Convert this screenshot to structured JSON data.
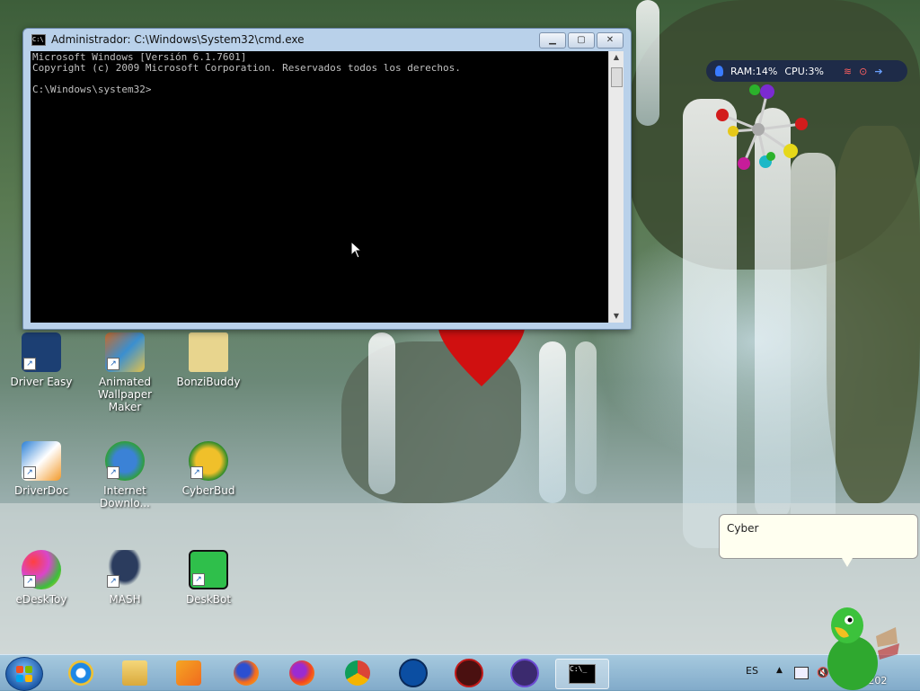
{
  "cmd_window": {
    "title": "Administrador: C:\\Windows\\System32\\cmd.exe",
    "lines": [
      "Microsoft Windows [Versión 6.1.7601]",
      "Copyright (c) 2009 Microsoft Corporation. Reservados todos los derechos.",
      "",
      "C:\\Windows\\system32>"
    ]
  },
  "monitor": {
    "ram": "RAM:14%",
    "cpu": "CPU:3%"
  },
  "desktop_icons": [
    {
      "label": "Driver Easy",
      "color": "#1c3f73"
    },
    {
      "label": "Animated Wallpaper Maker",
      "color": "#c66a2b"
    },
    {
      "label": "BonziBuddy",
      "color": "#e8d58e"
    },
    {
      "label": "DriverDoc",
      "color": "#2a7fd6"
    },
    {
      "label": "Internet Downlo...",
      "color": "#2f9f3b"
    },
    {
      "label": "CyberBud",
      "color": "#f0c02a"
    },
    {
      "label": "eDeskToy",
      "color": "#d946c9"
    },
    {
      "label": "MASH",
      "color": "#2b3c5e"
    },
    {
      "label": "DeskBot",
      "color": "#2fbf4b"
    }
  ],
  "bubble": {
    "text": "Cyber"
  },
  "taskbar": {
    "language": "ES",
    "date": "23/8/202"
  }
}
